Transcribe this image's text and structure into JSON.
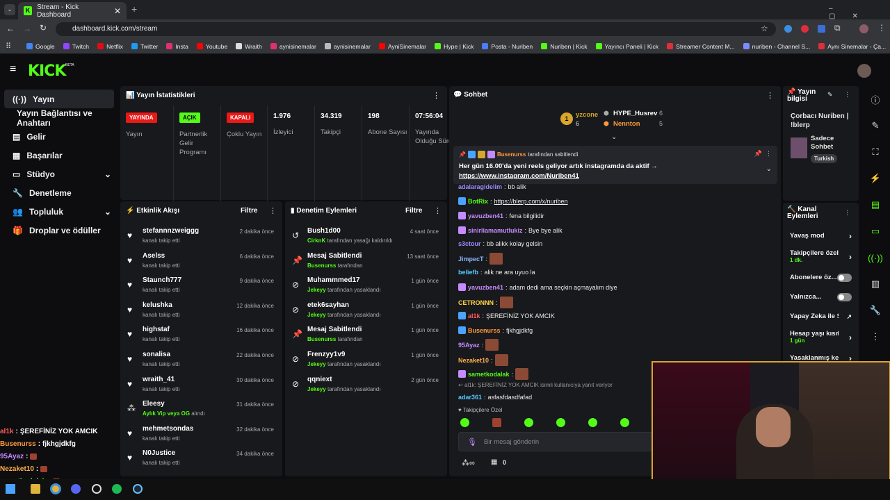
{
  "browser": {
    "tab_title": "Stream - Kick Dashboard",
    "url": "dashboard.kick.com/stream",
    "bookmarks": [
      "Google",
      "Twitch",
      "Netflix",
      "Twitter",
      "Insta",
      "Youtube",
      "Wraith",
      "aynisinemalar",
      "aynisinemalar",
      "AyniSinemalar",
      "Hype | Kick",
      "Posta - Nuriben",
      "Nuriben | Kick",
      "Yayıncı Paneli | Kick",
      "Streamer Content M...",
      "nuriben - Channel S...",
      "Aynı Sinemalar - Ça..."
    ]
  },
  "brand": {
    "logo": "KICK",
    "beta": "BETA",
    "accent": "#53fc18"
  },
  "sidebar": {
    "items": [
      {
        "label": "Yayın",
        "icon": "broadcast-icon"
      },
      {
        "label": "Yayın Bağlantısı ve Anahtarı",
        "icon": ""
      },
      {
        "label": "Gelir",
        "icon": "bank-icon"
      },
      {
        "label": "Başarılar",
        "icon": "grid-icon"
      },
      {
        "label": "Stüdyo",
        "icon": "studio-icon"
      },
      {
        "label": "Denetleme",
        "icon": "wrench-icon"
      },
      {
        "label": "Topluluk",
        "icon": "people-icon"
      },
      {
        "label": "Droplar ve ödüller",
        "icon": "gift-icon"
      }
    ]
  },
  "stats": {
    "title": "Yayın İstatistikleri",
    "cells": [
      {
        "badge": "YAYINDA",
        "badge_color": "#e91916",
        "label": "Yayın"
      },
      {
        "badge": "AÇIK",
        "badge_color": "#53fc18",
        "label": "Partnerlik Gelir Programı"
      },
      {
        "badge": "KAPALI",
        "badge_color": "#e91916",
        "label": "Çoklu Yayın"
      },
      {
        "value": "1.976",
        "label": "İzleyici"
      },
      {
        "value": "34.319",
        "label": "Takipçi"
      },
      {
        "value": "198",
        "label": "Abone Sayısı"
      },
      {
        "value": "07:56:04",
        "label": "Yayında Olduğu Süre"
      }
    ]
  },
  "activity": {
    "title": "Etkinlik Akışı",
    "filter": "Filtre",
    "rows": [
      {
        "name": "stefannnzweiggg",
        "sub": "kanalı takip etti",
        "time": "2 dakika önce"
      },
      {
        "name": "Aselss",
        "sub": "kanalı takip etti",
        "time": "6 dakika önce"
      },
      {
        "name": "Staunch777",
        "sub": "kanalı takip etti",
        "time": "9 dakika önce"
      },
      {
        "name": "kelushka",
        "sub": "kanalı takip etti",
        "time": "12 dakika önce"
      },
      {
        "name": "highstaf",
        "sub": "kanalı takip etti",
        "time": "16 dakika önce"
      },
      {
        "name": "sonalisa",
        "sub": "kanalı takip etti",
        "time": "22 dakika önce"
      },
      {
        "name": "wraith_41",
        "sub": "kanalı takip etti",
        "time": "30 dakika önce"
      },
      {
        "name": "Eleesy",
        "sub_green": "Aylık Vip veya OG",
        "sub": "alındı",
        "time": "31 dakika önce"
      },
      {
        "name": "mehmetsondas",
        "sub": "kanalı takip etti",
        "time": "32 dakika önce"
      },
      {
        "name": "N0Justice",
        "sub": "kanalı takip etti",
        "time": "34 dakika önce"
      }
    ]
  },
  "moderation": {
    "title": "Denetim Eylemleri",
    "filter": "Filtre",
    "rows": [
      {
        "name": "Bush1d00",
        "actor": "CirknK",
        "sub": "tarafından yasağı kaldırıldı",
        "time": "4 saat önce",
        "icon": "undo-icon"
      },
      {
        "name": "Mesaj Sabitlendi",
        "actor": "Busenurss",
        "sub": "tarafından",
        "time": "13 saat önce",
        "icon": "pin-icon"
      },
      {
        "name": "Muhammmed17",
        "actor": "Jekeyy",
        "sub": "tarafından yasaklandı",
        "time": "1 gün önce",
        "icon": "ban-icon"
      },
      {
        "name": "etek6sayhan",
        "actor": "Jekeyy",
        "sub": "tarafından yasaklandı",
        "time": "1 gün önce",
        "icon": "ban-icon"
      },
      {
        "name": "Mesaj Sabitlendi",
        "actor": "Busenurss",
        "sub": "tarafından",
        "time": "1 gün önce",
        "icon": "pin-icon"
      },
      {
        "name": "Frenzyy1v9",
        "actor": "Jekeyy",
        "sub": "tarafından yasaklandı",
        "time": "1 gün önce",
        "icon": "ban-icon"
      },
      {
        "name": "qqniext",
        "actor": "Jekeyy",
        "sub": "tarafından yasaklandı",
        "time": "2 gün önce",
        "icon": "ban-icon"
      }
    ]
  },
  "chat": {
    "title": "Sohbet",
    "leaderboard": [
      {
        "rank": "1",
        "name": "yzcone",
        "count": "6"
      },
      {
        "name": "HYPE_Husrev",
        "count": "6"
      },
      {
        "name": "Nennton",
        "count": "5"
      }
    ],
    "pinned": {
      "by": "Busenurss",
      "by_suffix": "tarafından sabitlendi",
      "text": "Her gün 16.00'da yeni reels geliyor artık instagramda da aktif →",
      "link": "https://www.instagram.com/Nuriben41"
    },
    "messages": [
      {
        "user": "adalaragidelim",
        "color": "#9b8cff",
        "text": "bb alik"
      },
      {
        "user": "BotRix",
        "color": "#53fc18",
        "text": "https://blerp.com/x/nuriben",
        "link": true
      },
      {
        "user": "yavuzben41",
        "color": "#c58bff",
        "text": "fena bilgilidir"
      },
      {
        "user": "sinirliamamutlukiz",
        "color": "#c58bff",
        "text": "Bye bye alik"
      },
      {
        "user": "s3ctour",
        "color": "#9b8cff",
        "text": "bb alikk kolay gelsin"
      },
      {
        "user": "JimpecT",
        "color": "#8ab4ff",
        "text": ""
      },
      {
        "user": "beliefb",
        "color": "#53c8ff",
        "text": "alik ne ara uyuo la"
      },
      {
        "user": "yavuzben41",
        "color": "#c58bff",
        "text": "adam dedi ama seçkin açmayalım diye"
      },
      {
        "user": "CETRONNN",
        "color": "#ffd54a",
        "text": ""
      },
      {
        "user": "al1k",
        "color": "#ff5a5a",
        "text": "ŞEREFİNİZ YOK AMCIK"
      },
      {
        "user": "Busenurss",
        "color": "#ff9a3c",
        "text": "fjkhgjdkfg"
      },
      {
        "user": "95Ayaz",
        "color": "#c58bff",
        "text": ""
      },
      {
        "user": "Nezaket10",
        "color": "#ffb04a",
        "text": ""
      },
      {
        "user": "sametkodalak",
        "color": "#53fc18",
        "text": ""
      },
      {
        "user": "adar361",
        "color": "#53c8ff",
        "text": "asfasfdasdfafad"
      }
    ],
    "reply_note": "al1k: ŞEREFİNİZ YOK AMCIK isimli kullanıcıya yanıt veriyor",
    "followers_only": "Takipçilere Özel",
    "input_placeholder": "Bir mesaj gönderin",
    "counter": "0"
  },
  "stream_info": {
    "title": "Yayın bilgisi",
    "stream_title": "Çorbacı Nuriben | !blerp",
    "category": "Sadece Sohbet",
    "tag": "Turkish"
  },
  "channel_actions": {
    "title": "Kanal Eylemleri",
    "items": [
      {
        "label": "Yavaş mod"
      },
      {
        "label": "Takipçilere özel s",
        "sub": "1 dk."
      },
      {
        "label": "Abonelere öz..."
      },
      {
        "label": "Yalnızca..."
      },
      {
        "label": "Yapay Zeka ile Sohbet Denetimi"
      },
      {
        "label": "Hesap yaşı kısıtla",
        "sub": "1 gün"
      },
      {
        "label": "Yasaklanmış kelin"
      }
    ]
  },
  "overlay": {
    "lines": [
      {
        "user": "al1k",
        "text": "ŞEREFİNİZ YOK AMCIK",
        "color": "#ff5a5a"
      },
      {
        "user": "Busenurss",
        "text": "fjkhgjdkfg",
        "color": "#ff9a3c"
      },
      {
        "user": "95Ayaz",
        "text": "",
        "color": "#c58bff"
      },
      {
        "user": "Nezaket10",
        "text": "",
        "color": "#ffb04a"
      },
      {
        "user": "sametkodalak",
        "text": "",
        "color": "#53fc18"
      },
      {
        "user": "adar361",
        "text": "asfasfdasdfafad",
        "color": "#53c8ff"
      }
    ]
  }
}
